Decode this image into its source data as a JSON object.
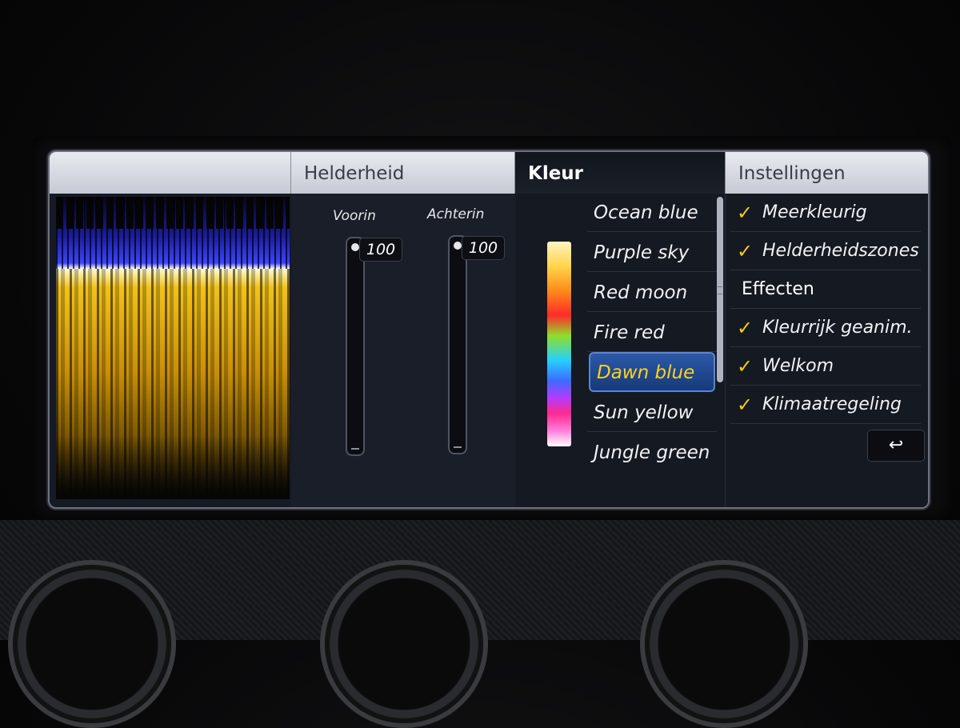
{
  "tabs": {
    "brightness": "Helderheid",
    "color": "Kleur",
    "settings": "Instellingen"
  },
  "brightness": {
    "front_label": "Voorin",
    "front_value": "100",
    "rear_label": "Achterin",
    "rear_value": "100"
  },
  "colors": {
    "items": [
      "Ocean blue",
      "Purple sky",
      "Red moon",
      "Fire red",
      "Dawn blue",
      "Sun yellow",
      "Jungle green"
    ],
    "selected": "Dawn blue"
  },
  "settings": {
    "items": [
      {
        "label": "Meerkleurig",
        "checked": true
      },
      {
        "label": "Helderheidszones",
        "checked": true
      }
    ],
    "effects_heading": "Effecten",
    "effects": [
      {
        "label": "Kleurrijk geanim.",
        "checked": true
      },
      {
        "label": "Welkom",
        "checked": true
      },
      {
        "label": "Klimaatregeling",
        "checked": true
      }
    ],
    "check_glyph": "✓",
    "back_icon": "↩"
  },
  "theme": {
    "selected_text": "#ffd21a",
    "check_color": "#f3c91c",
    "selected_bg": "#2c59a8"
  }
}
